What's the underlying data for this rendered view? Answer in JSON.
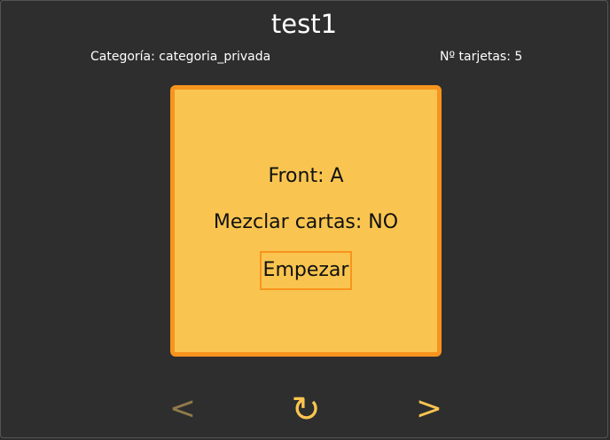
{
  "deck": {
    "title": "test1",
    "category_text": "Categoría: categoria_privada",
    "cards_count_text": "Nº tarjetas: 5"
  },
  "card": {
    "front_text": "Front: A",
    "shuffle_text": "Mezclar cartas: NO",
    "start_label": "Empezar"
  },
  "controls": {
    "prev_label": "<",
    "reload_label": "↻",
    "next_label": ">",
    "prev_icon": "chevron-left-icon",
    "reload_icon": "reload-icon",
    "next_icon": "chevron-right-icon"
  },
  "colors": {
    "background": "#2e2e2e",
    "card_fill": "#f9c550",
    "card_border": "#f7941d",
    "disabled_arrow": "#8f7a4a"
  }
}
